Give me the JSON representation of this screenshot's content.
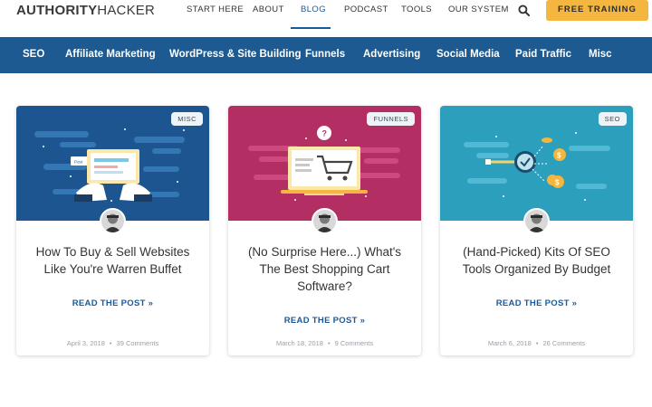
{
  "header": {
    "logo_bold": "AUTHORITY",
    "logo_light": "HACKER",
    "nav": [
      "START HERE",
      "ABOUT",
      "BLOG",
      "PODCAST",
      "TOOLS",
      "OUR SYSTEM"
    ],
    "active_nav": "BLOG",
    "cta_label": "FREE TRAINING"
  },
  "categories": [
    "SEO",
    "Affiliate Marketing",
    "WordPress & Site Building",
    "Funnels",
    "Advertising",
    "Social Media",
    "Paid Traffic",
    "Misc"
  ],
  "cards": [
    {
      "tag": "MISC",
      "title": "How To Buy & Sell Websites Like You're Warren Buffet",
      "read_label": "READ THE POST »",
      "date": "April 3, 2018",
      "comments": "39 Comments",
      "image_color": "#1d5590"
    },
    {
      "tag": "FUNNELS",
      "title": "(No Surprise Here...) What's The Best Shopping Cart Software?",
      "read_label": "READ THE POST »",
      "date": "March 18, 2018",
      "comments": "9 Comments",
      "image_color": "#b32f63"
    },
    {
      "tag": "SEO",
      "title": "(Hand-Picked) Kits Of SEO Tools Organized By Budget",
      "read_label": "READ THE POST »",
      "date": "March 6, 2018",
      "comments": "26 Comments",
      "image_color": "#2c9fbd"
    }
  ],
  "icons": {
    "search": "search-icon",
    "image_text": "Post"
  },
  "colors": {
    "brand_blue": "#1c5a91",
    "cta_yellow": "#f4b63f"
  }
}
